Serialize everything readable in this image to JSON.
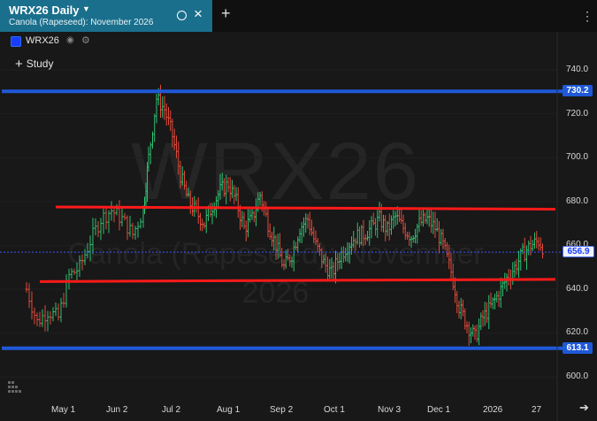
{
  "tab": {
    "title": "WRX26 Daily",
    "subtitle": "Canola (Rapeseed): November 2026"
  },
  "legend": {
    "symbol": "WRX26",
    "swatch_color": "#1a3cff"
  },
  "study_label": "Study",
  "watermark": {
    "line1": "WRX26",
    "line2": "Canola (Rapeseed): November",
    "line3": "2026"
  },
  "icons": {
    "caret": "caret-down-icon",
    "indicator": "circle-icon",
    "close": "close-icon",
    "add": "plus-icon",
    "menu": "more-vertical-icon",
    "visibility": "eye-icon",
    "settings": "gear-icon",
    "logo": "barchart-logo-icon",
    "scroll": "arrow-right-icon"
  },
  "chart_data": {
    "type": "bar",
    "subtype": "ohlc-daily",
    "symbol": "WRX26",
    "y_axis": {
      "min": 596,
      "max": 746,
      "ticks": [
        "740.0",
        "720.0",
        "700.0",
        "680.0",
        "660.0",
        "640.0",
        "620.0",
        "600.0"
      ],
      "position": "right"
    },
    "x_axis": {
      "ticks": [
        "May 1",
        "Jun 2",
        "Jul 2",
        "Aug 1",
        "Sep 2",
        "Oct 1",
        "Nov 3",
        "Dec 1",
        "2026",
        "27"
      ]
    },
    "last_price": "656.9",
    "colors": {
      "up": "#2fbf71",
      "down": "#e04a3a",
      "support_line": "#ff1a1a",
      "level_line": "#1f59d8"
    },
    "horizontal_levels": [
      {
        "value": 730.2,
        "label": "730.2",
        "color": "#1f59d8"
      },
      {
        "value": 613.1,
        "label": "613.1",
        "color": "#1f59d8"
      }
    ],
    "trend_lines": [
      {
        "from": {
          "x": 0.075,
          "y": 677.5
        },
        "to": {
          "x": 1.0,
          "y": 676.5
        },
        "color": "#ff1a1a"
      },
      {
        "from": {
          "x": 0.045,
          "y": 643.5
        },
        "to": {
          "x": 1.0,
          "y": 644.5
        },
        "color": "#ff1a1a"
      }
    ],
    "close_series": [
      {
        "x": 0.02,
        "c": 640
      },
      {
        "x": 0.04,
        "c": 625
      },
      {
        "x": 0.06,
        "c": 630
      },
      {
        "x": 0.08,
        "c": 627
      },
      {
        "x": 0.1,
        "c": 646
      },
      {
        "x": 0.12,
        "c": 650
      },
      {
        "x": 0.14,
        "c": 662
      },
      {
        "x": 0.16,
        "c": 672
      },
      {
        "x": 0.18,
        "c": 676
      },
      {
        "x": 0.2,
        "c": 672
      },
      {
        "x": 0.22,
        "c": 665
      },
      {
        "x": 0.24,
        "c": 676
      },
      {
        "x": 0.25,
        "c": 700
      },
      {
        "x": 0.265,
        "c": 727
      },
      {
        "x": 0.28,
        "c": 722
      },
      {
        "x": 0.295,
        "c": 710
      },
      {
        "x": 0.31,
        "c": 692
      },
      {
        "x": 0.325,
        "c": 680
      },
      {
        "x": 0.34,
        "c": 675
      },
      {
        "x": 0.355,
        "c": 670
      },
      {
        "x": 0.37,
        "c": 678
      },
      {
        "x": 0.385,
        "c": 685
      },
      {
        "x": 0.4,
        "c": 688
      },
      {
        "x": 0.415,
        "c": 680
      },
      {
        "x": 0.43,
        "c": 668
      },
      {
        "x": 0.445,
        "c": 672
      },
      {
        "x": 0.46,
        "c": 683
      },
      {
        "x": 0.475,
        "c": 670
      },
      {
        "x": 0.49,
        "c": 660
      },
      {
        "x": 0.505,
        "c": 650
      },
      {
        "x": 0.52,
        "c": 656
      },
      {
        "x": 0.535,
        "c": 668
      },
      {
        "x": 0.55,
        "c": 672
      },
      {
        "x": 0.565,
        "c": 660
      },
      {
        "x": 0.58,
        "c": 652
      },
      {
        "x": 0.595,
        "c": 647
      },
      {
        "x": 0.61,
        "c": 655
      },
      {
        "x": 0.625,
        "c": 660
      },
      {
        "x": 0.64,
        "c": 664
      },
      {
        "x": 0.655,
        "c": 665
      },
      {
        "x": 0.67,
        "c": 668
      },
      {
        "x": 0.685,
        "c": 672
      },
      {
        "x": 0.7,
        "c": 667
      },
      {
        "x": 0.715,
        "c": 673
      },
      {
        "x": 0.73,
        "c": 668
      },
      {
        "x": 0.745,
        "c": 664
      },
      {
        "x": 0.76,
        "c": 670
      },
      {
        "x": 0.775,
        "c": 672
      },
      {
        "x": 0.79,
        "c": 668
      },
      {
        "x": 0.805,
        "c": 660
      },
      {
        "x": 0.82,
        "c": 648
      },
      {
        "x": 0.835,
        "c": 632
      },
      {
        "x": 0.85,
        "c": 624
      },
      {
        "x": 0.865,
        "c": 618
      },
      {
        "x": 0.88,
        "c": 627
      },
      {
        "x": 0.895,
        "c": 632
      },
      {
        "x": 0.91,
        "c": 638
      },
      {
        "x": 0.925,
        "c": 645
      },
      {
        "x": 0.94,
        "c": 650
      },
      {
        "x": 0.955,
        "c": 656
      },
      {
        "x": 0.97,
        "c": 660
      },
      {
        "x": 0.985,
        "c": 662
      },
      {
        "x": 1.0,
        "c": 656.9
      }
    ]
  }
}
